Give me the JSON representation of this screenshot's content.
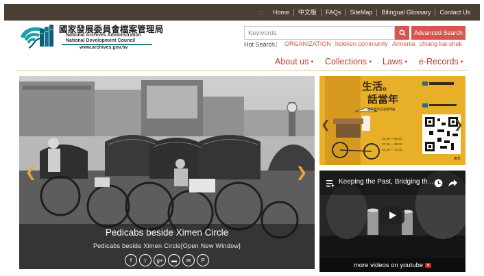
{
  "topbar": {
    "links": [
      "Home",
      "中文版",
      "FAQs",
      "SiteMap",
      "Bilingual Glossary",
      "Contact Us"
    ]
  },
  "logo": {
    "zh": "國家發展委員會檔案管理局",
    "en_line1": "National Archives Administration",
    "en_line2": "National Development Council",
    "url": "www.archives.gov.tw"
  },
  "search": {
    "placeholder": "Keywords",
    "value": "",
    "advanced_label": "Advanced Search",
    "hot_label": "Hot Search：",
    "hot_terms": [
      "ORGANIZATION",
      "hokkien community",
      "Armenia",
      "chiang kai-shek"
    ]
  },
  "nav": {
    "items": [
      "About us",
      "Collections",
      "Laws",
      "e-Records"
    ]
  },
  "slider": {
    "title": "Pedicabs beside Ximen Circle",
    "subtitle": "Pedicabs beside Ximen Circle[Open New Window]",
    "share_icons": [
      "facebook-icon",
      "twitter-icon",
      "google-plus-icon",
      "line-icon",
      "email-icon",
      "plurk-icon"
    ]
  },
  "poster": {
    "title_line1": "生活。",
    "title_line2": "話當年",
    "subtitle": "國家檔案巡迴展特展",
    "dates": "10.20 — 06.01\n07.06 — 09.22\n10.19 — 12.30",
    "corner": "廣告"
  },
  "video": {
    "title": "Keeping the Past, Bridging th...",
    "more": "more videos on youtube"
  },
  "colors": {
    "topbar": "#4a3f33",
    "accent_red": "#d9534f",
    "nav_red": "#c0392b",
    "poster_yellow": "#e8b028"
  }
}
